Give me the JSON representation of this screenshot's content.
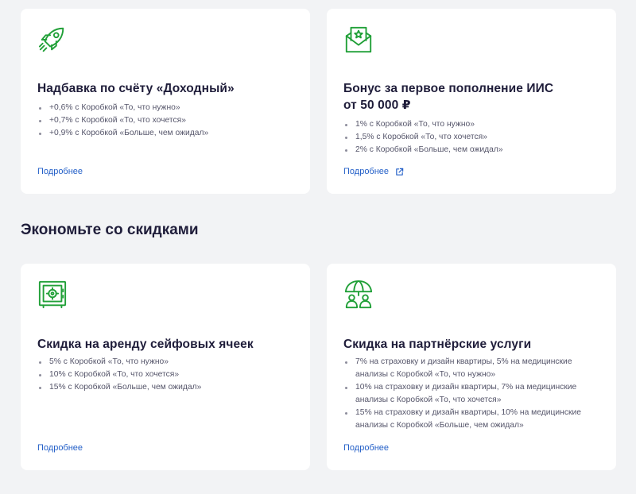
{
  "cards": [
    {
      "icon": "rocket-icon",
      "title": "Надбавка по счёту «Доходный»",
      "items": [
        "+0,6% с Коробкой «То, что нужно»",
        "+0,7% с Коробкой «То, что хочется»",
        "+0,9% с Коробкой «Больше, чем ожидал»"
      ],
      "link": "Подробнее"
    },
    {
      "icon": "envelope-star-icon",
      "title": "Бонус за первое пополнение ИИС от 50 000 ₽",
      "items": [
        "1% с Коробкой «То, что нужно»",
        "1,5% с Коробкой «То, что хочется»",
        "2% с Коробкой «Больше, чем ожидал»"
      ],
      "link": "Подробнее",
      "link_icon": "external-link-icon"
    },
    {
      "icon": "safe-icon",
      "title": "Скидка на аренду сейфовых ячеек",
      "items": [
        "5% с Коробкой «То, что нужно»",
        "10% с Коробкой «То, что хочется»",
        "15% с Коробкой «Больше, чем ожидал»"
      ],
      "link": "Подробнее"
    },
    {
      "icon": "umbrella-people-icon",
      "title": "Скидка на партнёрские услуги",
      "items": [
        "7% на страховку и дизайн квартиры, 5% на медицинские анализы с Коробкой «То, что нужно»",
        "10% на страховку и дизайн квартиры, 7% на медицинские анализы с Коробкой «То, что хочется»",
        "15% на страховку и дизайн квартиры, 10% на медицинские анализы с Коробкой «Больше, чем ожидал»"
      ],
      "link": "Подробнее"
    }
  ],
  "section": {
    "title": "Экономьте со скидками"
  },
  "colors": {
    "accent": "#21a038",
    "link": "#2460c8",
    "text": "#1f1d3a",
    "background": "#f2f3f5"
  }
}
